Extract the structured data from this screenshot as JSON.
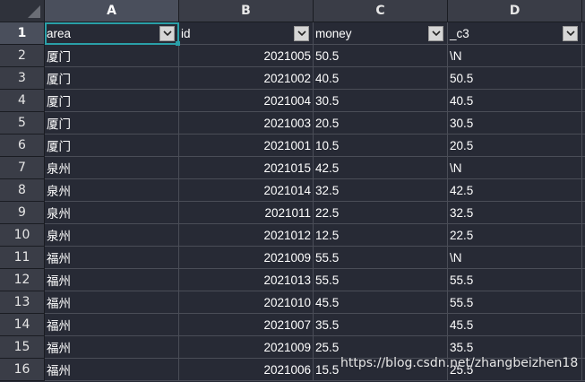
{
  "columns": [
    "A",
    "B",
    "C",
    "D"
  ],
  "header_row": {
    "row_number": "1",
    "cells": [
      "area",
      "id",
      "money",
      "_c3"
    ]
  },
  "rows": [
    {
      "n": "2",
      "area": "厦门",
      "id": "2021005",
      "money": "50.5",
      "c3": "\\N"
    },
    {
      "n": "3",
      "area": "厦门",
      "id": "2021002",
      "money": "40.5",
      "c3": "50.5"
    },
    {
      "n": "4",
      "area": "厦门",
      "id": "2021004",
      "money": "30.5",
      "c3": "40.5"
    },
    {
      "n": "5",
      "area": "厦门",
      "id": "2021003",
      "money": "20.5",
      "c3": "30.5"
    },
    {
      "n": "6",
      "area": "厦门",
      "id": "2021001",
      "money": "10.5",
      "c3": "20.5"
    },
    {
      "n": "7",
      "area": "泉州",
      "id": "2021015",
      "money": "42.5",
      "c3": "\\N"
    },
    {
      "n": "8",
      "area": "泉州",
      "id": "2021014",
      "money": "32.5",
      "c3": "42.5"
    },
    {
      "n": "9",
      "area": "泉州",
      "id": "2021011",
      "money": "22.5",
      "c3": "32.5"
    },
    {
      "n": "10",
      "area": "泉州",
      "id": "2021012",
      "money": "12.5",
      "c3": "22.5"
    },
    {
      "n": "11",
      "area": "福州",
      "id": "2021009",
      "money": "55.5",
      "c3": "\\N"
    },
    {
      "n": "12",
      "area": "福州",
      "id": "2021013",
      "money": "55.5",
      "c3": "55.5"
    },
    {
      "n": "13",
      "area": "福州",
      "id": "2021010",
      "money": "45.5",
      "c3": "55.5"
    },
    {
      "n": "14",
      "area": "福州",
      "id": "2021007",
      "money": "35.5",
      "c3": "45.5"
    },
    {
      "n": "15",
      "area": "福州",
      "id": "2021009",
      "money": "25.5",
      "c3": "35.5"
    },
    {
      "n": "16",
      "area": "福州",
      "id": "2021006",
      "money": "15.5",
      "c3": "25.5"
    }
  ],
  "watermark": "https://blog.csdn.net/zhangbeizhen18",
  "colors": {
    "background": "#272a35",
    "header_background": "#3a3d47",
    "selection": "#2a9fa8"
  },
  "icons": [
    "select-all-icon",
    "filter-dropdown-icon"
  ]
}
